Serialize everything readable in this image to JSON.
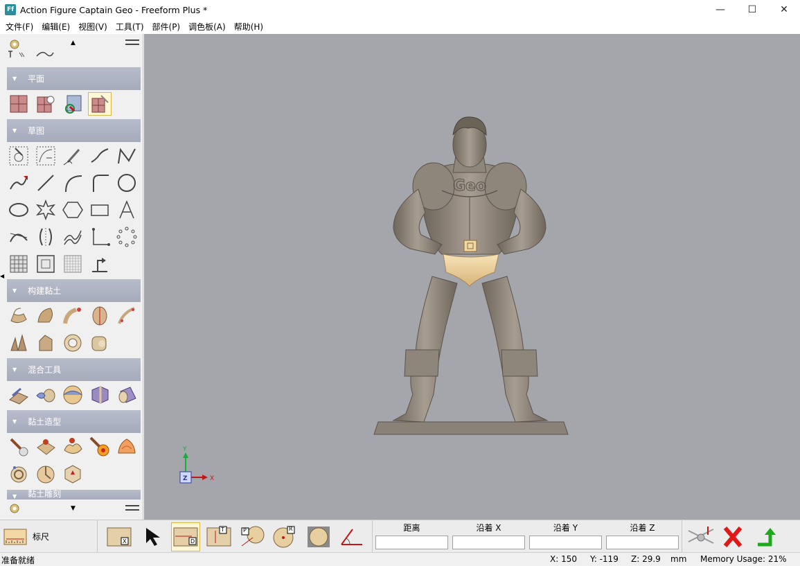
{
  "window": {
    "app_icon": "Ff",
    "title": "Action Figure Captain Geo - Freeform Plus *",
    "minimize": "—",
    "maximize": "☐",
    "close": "✕"
  },
  "menu": [
    "文件(F)",
    "编辑(E)",
    "视图(V)",
    "工具(T)",
    "部件(P)",
    "调色板(A)",
    "帮助(H)"
  ],
  "sections": [
    "平面",
    "草图",
    "构建黏土",
    "混合工具",
    "黏土造型",
    "黏土雕刻"
  ],
  "model_text": "Geo",
  "axis": {
    "y": "Y",
    "z": "Z",
    "x": "X"
  },
  "bottom": {
    "ruler_label": "标尺",
    "tool_badges": [
      "X",
      "D",
      "T",
      "P",
      "R"
    ],
    "measure_labels": [
      "距离",
      "沿着 X",
      "沿着 Y",
      "沿着 Z"
    ],
    "measure_values": [
      "",
      "",
      "",
      ""
    ]
  },
  "status": {
    "ready": "准备就绪",
    "x": "X:  150",
    "y": "Y: -119",
    "z": "Z:  29.9",
    "unit": "mm",
    "memory": "Memory Usage: 21%"
  },
  "colors": {
    "viewport": "#a4a6ac",
    "section_header": "#aaaebd",
    "clay": "#8d8377",
    "clay_selected": "#f2d8a4"
  }
}
